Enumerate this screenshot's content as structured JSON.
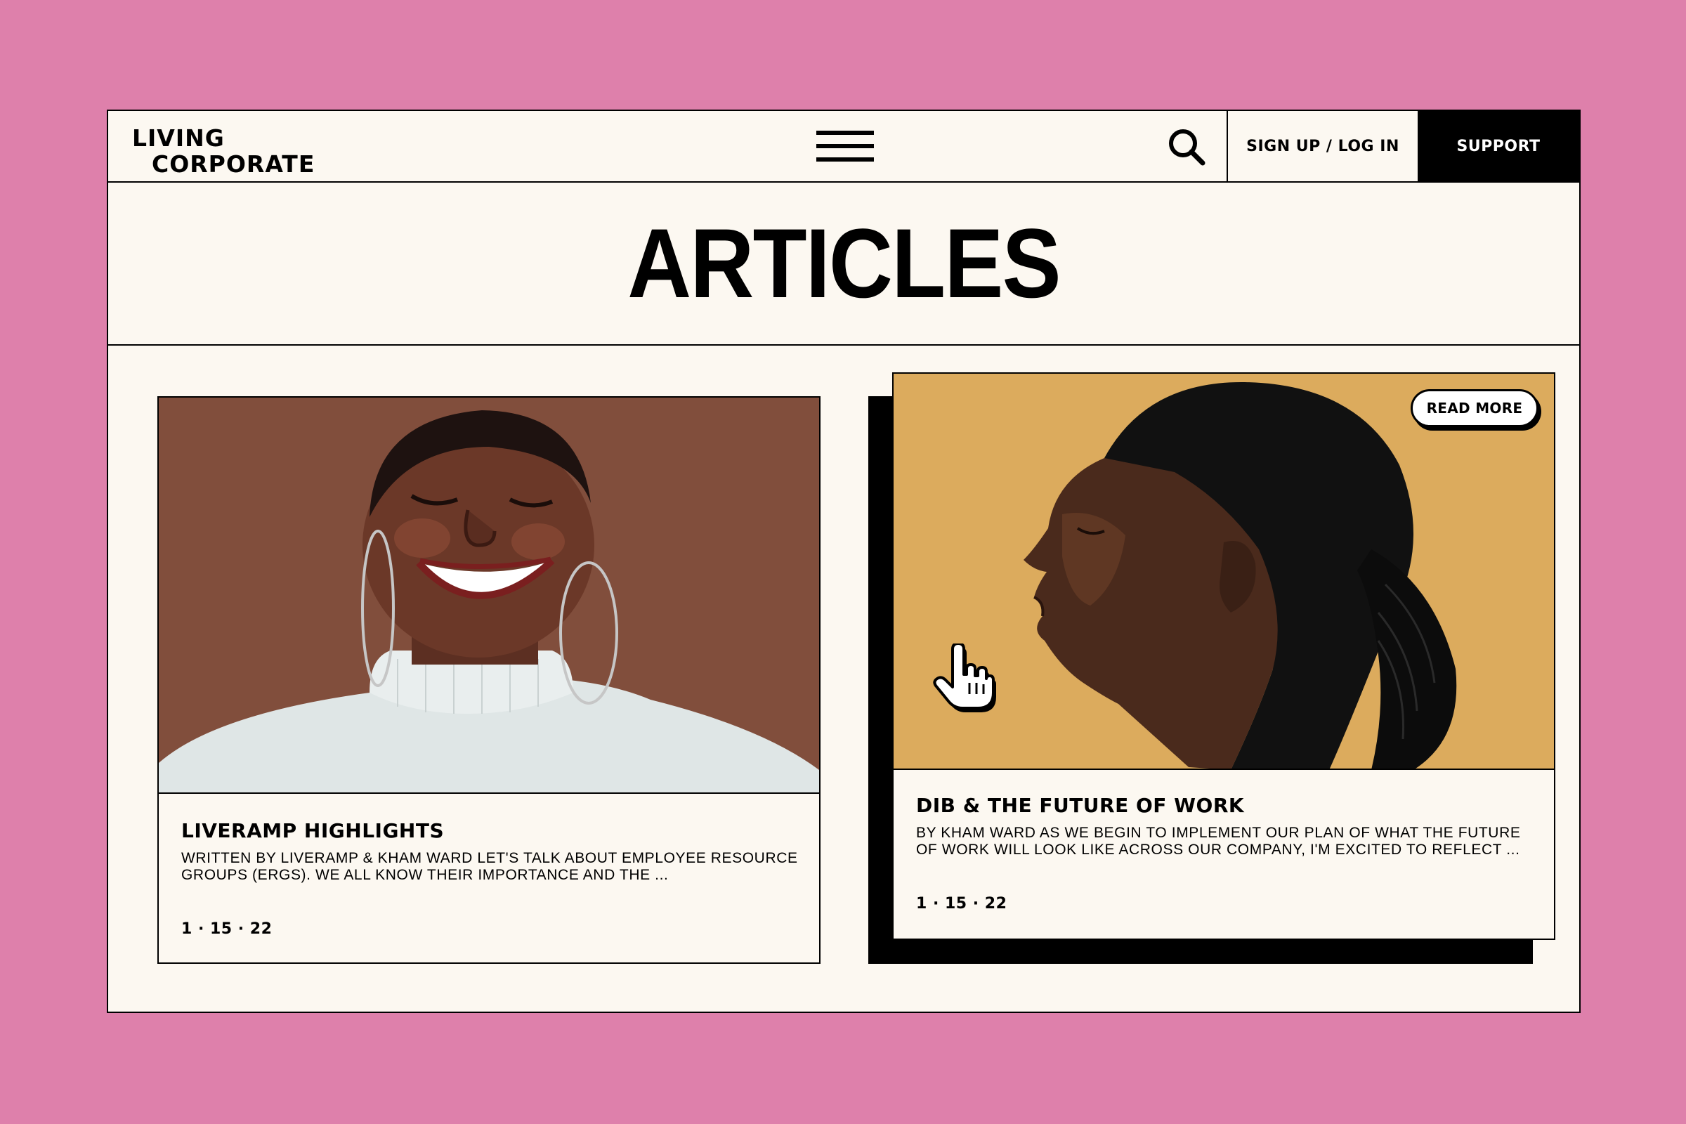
{
  "colors": {
    "page_background": "#de80ab",
    "panel_background": "#fcf8f1",
    "ink": "#000000",
    "card1_image_bg": "#7d4b3a",
    "card2_image_bg": "#dcab5d"
  },
  "header": {
    "logo_line1": "LIVING",
    "logo_line2": "CORPORATE",
    "menu_icon": "hamburger-icon",
    "search_icon": "search-icon",
    "signup_label": "SIGN UP / LOG IN",
    "support_label": "SUPPORT"
  },
  "page": {
    "title": "ARTICLES"
  },
  "articles": [
    {
      "title": "LIVERAMP HIGHLIGHTS",
      "excerpt": "WRITTEN BY LIVERAMP & KHAM WARD LET'S TALK ABOUT EMPLOYEE RESOURCE GROUPS (ERGS). WE ALL KNOW THEIR IMPORTANCE AND THE ...",
      "date": "1 · 15 · 22",
      "image": "portrait-smiling-woman-turtleneck"
    },
    {
      "title": "DIB & THE FUTURE OF WORK",
      "excerpt": "BY KHAM WARD AS WE BEGIN TO IMPLEMENT OUR PLAN OF WHAT THE FUTURE OF WORK WILL LOOK LIKE ACROSS OUR COMPANY, I'M EXCITED TO REFLECT ...",
      "date": "1 · 15 · 22",
      "image": "profile-woman-braided-ponytail",
      "read_more_label": "READ MORE",
      "cursor_icon": "hand-pointer-icon"
    }
  ]
}
